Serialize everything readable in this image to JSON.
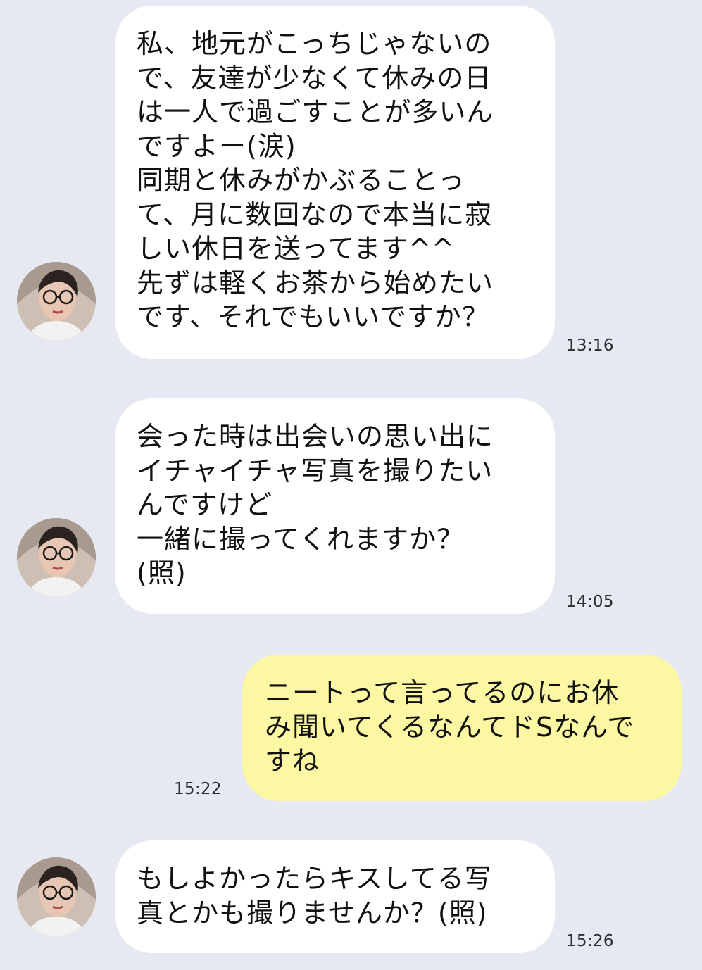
{
  "messages": [
    {
      "sender": "other",
      "text": "私、地元がこっちじゃないの\nで、友達が少なくて休みの日\nは一人で過ごすことが多いん\nですよー(涙)\n同期と休みがかぶることっ\nて、月に数回なので本当に寂\nしい休日を送ってます^^\n先ずは軽くお茶から始めたい\nです、それでもいいですか？",
      "time": "13:16"
    },
    {
      "sender": "other",
      "text": "会った時は出会いの思い出に\nイチャイチャ写真を撮りたい\nんですけど\n一緒に撮ってくれますか？\n(照)",
      "time": "14:05"
    },
    {
      "sender": "me",
      "text": "ニートって言ってるのにお休\nみ聞いてくるなんてドSなんで\nすね",
      "time": "15:22"
    },
    {
      "sender": "other",
      "text": "もしよかったらキスしてる写\n真とかも撮りませんか？(照)",
      "time": "15:26"
    }
  ],
  "colors": {
    "background": "#e6e9f1",
    "incoming_bubble": "#ffffff",
    "outgoing_bubble": "#fbf7a3"
  },
  "icons": {
    "contact_avatar": "avatar-icon"
  }
}
